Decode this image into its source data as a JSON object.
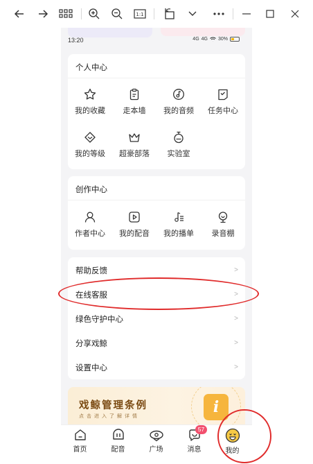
{
  "toolbar": {
    "buttons": [
      {
        "name": "back-arrow-icon"
      },
      {
        "name": "forward-arrow-icon"
      },
      {
        "name": "grid-view-icon"
      },
      {
        "name": "zoom-in-icon"
      },
      {
        "name": "zoom-out-icon"
      },
      {
        "name": "actual-size-icon",
        "label": "1:1"
      },
      {
        "name": "rotate-icon"
      },
      {
        "name": "chevron-down-icon"
      },
      {
        "name": "more-icon"
      },
      {
        "name": "minimize-icon"
      },
      {
        "name": "maximize-icon"
      },
      {
        "name": "close-icon"
      }
    ]
  },
  "status": {
    "time": "13:20",
    "signal_1": "4G",
    "signal_2": "4G",
    "battery": "30%"
  },
  "personal_center": {
    "title": "个人中心",
    "items": [
      {
        "label": "我的收藏",
        "icon": "star-icon"
      },
      {
        "label": "走本墙",
        "icon": "clipboard-icon"
      },
      {
        "label": "我的音频",
        "icon": "music-note-icon"
      },
      {
        "label": "任务中心",
        "icon": "task-icon"
      },
      {
        "label": "我的等级",
        "icon": "level-icon"
      },
      {
        "label": "超豪部落",
        "icon": "crown-icon"
      },
      {
        "label": "实验室",
        "icon": "lab-icon"
      }
    ]
  },
  "creation_center": {
    "title": "创作中心",
    "items": [
      {
        "label": "作者中心",
        "icon": "user-icon"
      },
      {
        "label": "我的配音",
        "icon": "play-box-icon"
      },
      {
        "label": "我的播单",
        "icon": "playlist-icon"
      },
      {
        "label": "录音棚",
        "icon": "microphone-icon"
      }
    ]
  },
  "menu": {
    "items": [
      {
        "label": "帮助反馈",
        "chevron": ">"
      },
      {
        "label": "在线客服",
        "chevron": ">"
      },
      {
        "label": "绿色守护中心",
        "chevron": ">"
      },
      {
        "label": "分享戏鲸",
        "chevron": ">"
      },
      {
        "label": "设置中心",
        "chevron": ">"
      }
    ]
  },
  "banner": {
    "title": "戏鲸管理条例",
    "subtitle": "点击进入了解详情",
    "badge": "i"
  },
  "tabbar": {
    "tabs": [
      {
        "label": "首页",
        "icon": "home-icon"
      },
      {
        "label": "配音",
        "icon": "dubbing-icon"
      },
      {
        "label": "广场",
        "icon": "plaza-icon"
      },
      {
        "label": "消息",
        "icon": "message-icon",
        "badge": "57"
      },
      {
        "label": "我的",
        "icon": "profile-face-icon",
        "active": true
      }
    ],
    "active_color": "#f6c945"
  },
  "annotations": {
    "color": "#e02b2b",
    "highlighted": [
      "在线客服",
      "我的"
    ]
  }
}
